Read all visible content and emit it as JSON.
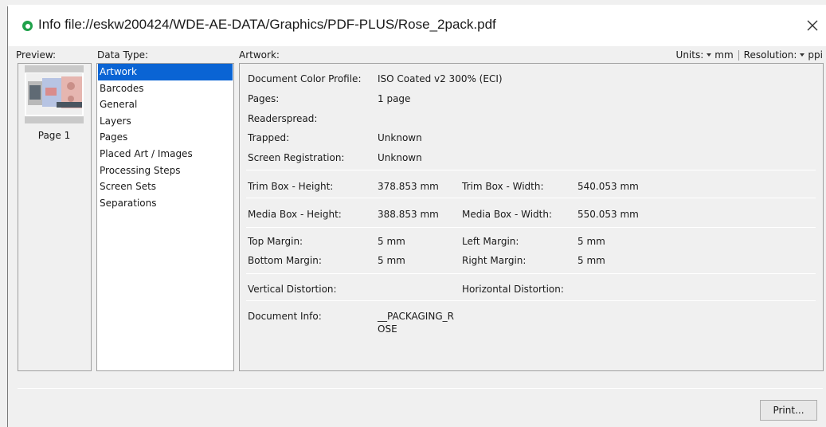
{
  "window": {
    "title": "Info file://eskw200424/WDE-AE-DATA/Graphics/PDF-PLUS/Rose_2pack.pdf",
    "status_color": "#1fa14a"
  },
  "preview": {
    "label": "Preview:",
    "page_label": "Page 1"
  },
  "data_type": {
    "label": "Data Type:",
    "selected_color": "#0a64d4",
    "items": [
      {
        "label": "Artwork",
        "selected": true
      },
      {
        "label": "Barcodes",
        "selected": false
      },
      {
        "label": "General",
        "selected": false
      },
      {
        "label": "Layers",
        "selected": false
      },
      {
        "label": "Pages",
        "selected": false
      },
      {
        "label": "Placed Art / Images",
        "selected": false
      },
      {
        "label": "Processing Steps",
        "selected": false
      },
      {
        "label": "Screen Sets",
        "selected": false
      },
      {
        "label": "Separations",
        "selected": false
      }
    ]
  },
  "artwork": {
    "label": "Artwork:",
    "units_label": "Units:",
    "units_value": "mm",
    "resolution_label": "Resolution:",
    "resolution_value": "ppi",
    "rows": {
      "color_profile": {
        "label": "Document Color Profile:",
        "value": "ISO Coated v2 300% (ECI)"
      },
      "pages": {
        "label": "Pages:",
        "value": "1 page"
      },
      "readerspread": {
        "label": "Readerspread:",
        "value": ""
      },
      "trapped": {
        "label": "Trapped:",
        "value": "Unknown"
      },
      "screen_registration": {
        "label": "Screen Registration:",
        "value": "Unknown"
      },
      "trim_height": {
        "label": "Trim Box - Height:",
        "value": "378.853 mm"
      },
      "trim_width": {
        "label": "Trim Box - Width:",
        "value": "540.053 mm"
      },
      "media_height": {
        "label": "Media Box - Height:",
        "value": "388.853 mm"
      },
      "media_width": {
        "label": "Media Box - Width:",
        "value": "550.053 mm"
      },
      "top_margin": {
        "label": "Top Margin:",
        "value": "5 mm"
      },
      "left_margin": {
        "label": "Left Margin:",
        "value": "5 mm"
      },
      "bottom_margin": {
        "label": "Bottom Margin:",
        "value": "5 mm"
      },
      "right_margin": {
        "label": "Right Margin:",
        "value": "5 mm"
      },
      "vertical_distortion": {
        "label": "Vertical Distortion:",
        "value": ""
      },
      "horizontal_distortion": {
        "label": "Horizontal Distortion:",
        "value": ""
      },
      "document_info": {
        "label": "Document Info:",
        "value_line1": "__PACKAGING_R",
        "value_line2": "OSE"
      }
    }
  },
  "footer": {
    "print_label": "Print..."
  }
}
